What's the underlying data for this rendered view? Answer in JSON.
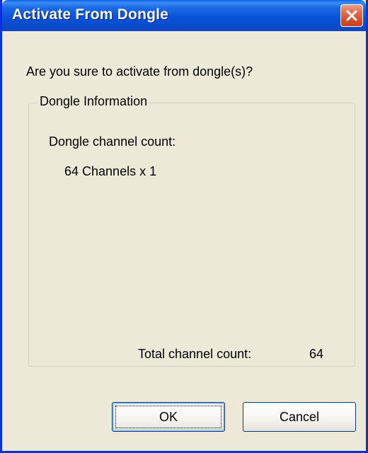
{
  "window": {
    "title": "Activate From Dongle"
  },
  "titlebar": {
    "close_icon": "close-icon",
    "accent": "#0a53d8",
    "close_color": "#d0502e"
  },
  "dialog": {
    "prompt": "Are you sure to activate from dongle(s)?",
    "group_title": "Dongle Information",
    "channel_count_label": "Dongle channel count:",
    "channel_entries": [
      "64 Channels x 1"
    ],
    "total_label": "Total channel count:",
    "total_value": "64"
  },
  "buttons": {
    "ok_label": "OK",
    "cancel_label": "Cancel"
  }
}
